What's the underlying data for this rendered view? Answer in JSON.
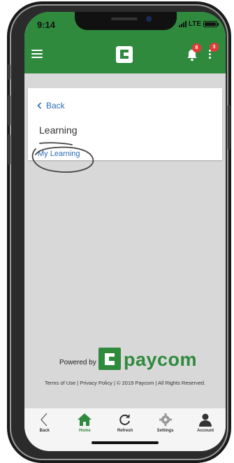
{
  "status": {
    "time": "9:14",
    "network": "LTE"
  },
  "header": {
    "notifications_count": "8",
    "menu_count": "3"
  },
  "card": {
    "back_label": "Back",
    "title": "Learning",
    "link_label": "My Learning"
  },
  "footer": {
    "powered_by": "Powered by",
    "brand": "paycom",
    "links": [
      "Terms of Use",
      "Privacy Policy"
    ],
    "copyright": "© 2019 Paycom | All Rights Reserved."
  },
  "tabs": [
    {
      "label": "Back",
      "icon": "chevron-left-icon"
    },
    {
      "label": "Home",
      "icon": "home-icon"
    },
    {
      "label": "Refresh",
      "icon": "refresh-icon"
    },
    {
      "label": "Settings",
      "icon": "gear-icon"
    },
    {
      "label": "Account",
      "icon": "user-icon"
    }
  ],
  "colors": {
    "brand_green": "#2f8a3e",
    "link_blue": "#2a6db5",
    "badge_red": "#e23b3b"
  }
}
